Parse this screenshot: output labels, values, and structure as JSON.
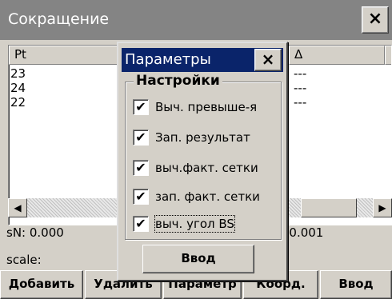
{
  "window": {
    "title": "Сокращение",
    "close_label": "×"
  },
  "list": {
    "columns": [
      "Pt",
      "",
      "Δ",
      ""
    ],
    "rows": [
      "23",
      "24",
      "22"
    ],
    "col3_values": [
      "---",
      "---",
      "---"
    ]
  },
  "scrollbar": {
    "left_arrow": "◀",
    "right_arrow": "▶"
  },
  "info": {
    "sn": "sN: 0.000",
    "scale": "scale:",
    "right_value": "-0.001"
  },
  "toolbar": {
    "add": "Добавить",
    "delete": "Удалить",
    "params": "Параметр",
    "coords": "Коорд.",
    "enter": "Ввод"
  },
  "dialog": {
    "title": "Параметры",
    "close_label": "×",
    "group_label": "Настройки",
    "checkboxes": [
      {
        "label": "Выч. превыше-я",
        "checked": "✔"
      },
      {
        "label": "Зап. результат",
        "checked": "✔"
      },
      {
        "label": "выч.факт. сетки",
        "checked": "✔"
      },
      {
        "label": "зап. факт. сетки",
        "checked": "✔"
      },
      {
        "label": "выч. угол BS",
        "checked": "✔"
      }
    ],
    "ok_label": "Ввод"
  }
}
